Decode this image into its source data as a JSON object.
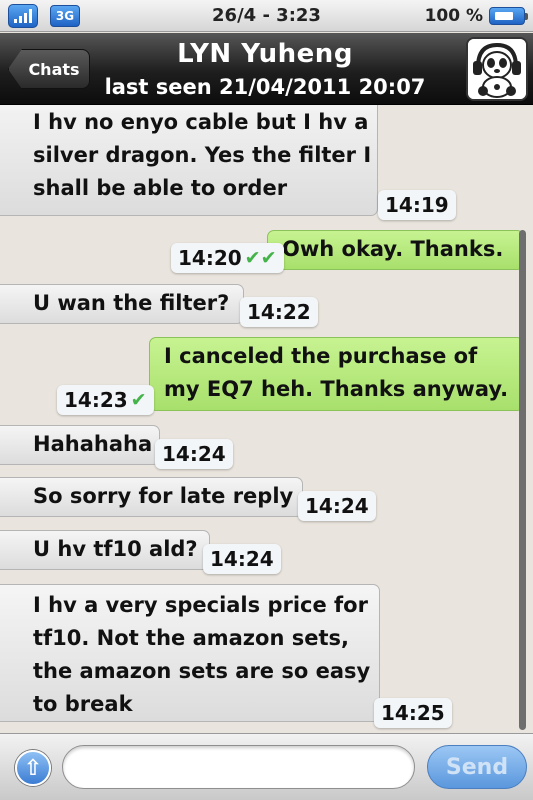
{
  "status_bar": {
    "network_label": "3G",
    "datetime": "26/4 - 3:23",
    "battery_percent": "100 %"
  },
  "header": {
    "back_label": "Chats",
    "contact_name": "LYN Yuheng",
    "last_seen": "last seen 21/04/2011 20:07"
  },
  "messages": [
    {
      "direction": "in",
      "lines": [
        "I hv no enyo cable but I hv a",
        "silver dragon. Yes the filter I",
        "shall be able to order"
      ],
      "time": "14:19"
    },
    {
      "direction": "out",
      "lines": [
        "Owh okay. Thanks."
      ],
      "time": "14:20",
      "status": "read"
    },
    {
      "direction": "in",
      "lines": [
        "U wan the filter?"
      ],
      "time": "14:22"
    },
    {
      "direction": "out",
      "lines": [
        "I canceled the purchase of",
        "my EQ7 heh. Thanks anyway."
      ],
      "time": "14:23",
      "status": "sent"
    },
    {
      "direction": "in",
      "lines": [
        "Hahahaha"
      ],
      "time": "14:24"
    },
    {
      "direction": "in",
      "lines": [
        "So sorry for late reply"
      ],
      "time": "14:24"
    },
    {
      "direction": "in",
      "lines": [
        "U hv tf10 ald?"
      ],
      "time": "14:24"
    },
    {
      "direction": "in",
      "lines": [
        "I hv a very specials price for",
        "tf10. Not the amazon sets,",
        "the amazon sets are so easy",
        "to break"
      ],
      "time": "14:25"
    }
  ],
  "input_bar": {
    "message_value": "",
    "send_label": "Send"
  },
  "colors": {
    "outgoing_bubble": "#b5e87c",
    "incoming_bubble": "#e6e6e6",
    "read_tick": "#44b34a",
    "header_bg": "#1e1e1e"
  }
}
